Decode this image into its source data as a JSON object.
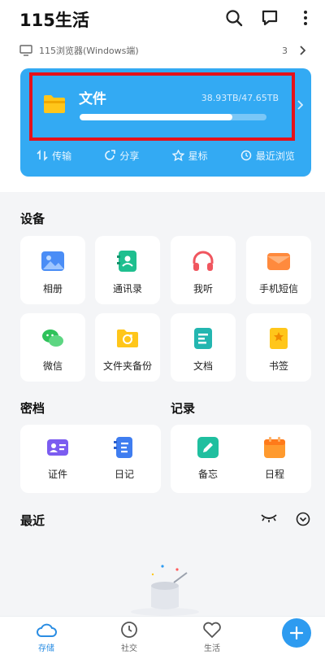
{
  "header": {
    "title": "115生活"
  },
  "device": {
    "name": "115浏览器(Windows端)",
    "count": "3"
  },
  "file_card": {
    "label": "文件",
    "size": "38.93TB/47.65TB",
    "usage_fraction": 0.817
  },
  "quick_actions": [
    "传输",
    "分享",
    "星标",
    "最近浏览"
  ],
  "devices_section": {
    "title": "设备",
    "items": [
      "相册",
      "通讯录",
      "我听",
      "手机短信",
      "微信",
      "文件夹备份",
      "文档",
      "书签"
    ]
  },
  "vault_section": {
    "title": "密档",
    "items": [
      "证件",
      "日记"
    ]
  },
  "records_section": {
    "title": "记录",
    "items": [
      "备忘",
      "日程"
    ]
  },
  "recent_section": {
    "title": "最近"
  },
  "bottom_nav": [
    "存储",
    "社交",
    "生活"
  ],
  "colors": {
    "card_blue": "#33aaf3",
    "highlight_red": "#e5111a",
    "nav_active": "#2a8de3"
  }
}
